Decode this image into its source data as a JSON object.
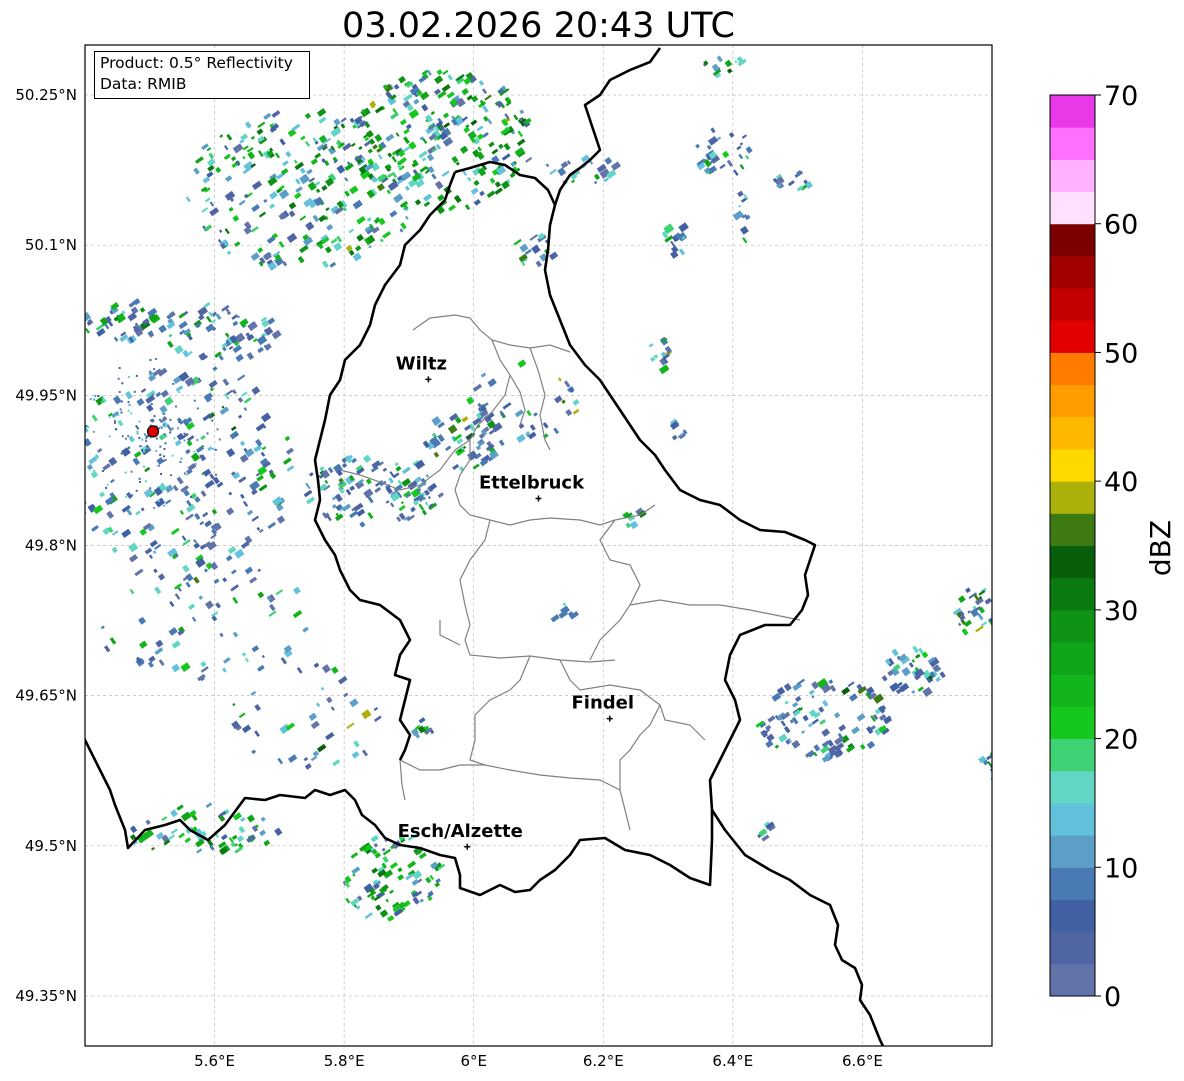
{
  "title": "03.02.2026 20:43 UTC",
  "info": {
    "product": "Product: 0.5° Reflectivity",
    "data": "Data: RMIB"
  },
  "map": {
    "lon_range": [
      5.4,
      6.8
    ],
    "lat_range": [
      49.3,
      50.3
    ],
    "lat_ticks": [
      {
        "label": "50.25°N",
        "value": 50.25
      },
      {
        "label": "50.1°N",
        "value": 50.1
      },
      {
        "label": "49.95°N",
        "value": 49.95
      },
      {
        "label": "49.8°N",
        "value": 49.8
      },
      {
        "label": "49.65°N",
        "value": 49.65
      },
      {
        "label": "49.5°N",
        "value": 49.5
      },
      {
        "label": "49.35°N",
        "value": 49.35
      }
    ],
    "lon_ticks": [
      {
        "label": "5.6°E",
        "value": 5.6
      },
      {
        "label": "5.8°E",
        "value": 5.8
      },
      {
        "label": "6°E",
        "value": 6.0
      },
      {
        "label": "6.2°E",
        "value": 6.2
      },
      {
        "label": "6.4°E",
        "value": 6.4
      },
      {
        "label": "6.6°E",
        "value": 6.6
      }
    ],
    "cities": [
      {
        "name": "Wiltz",
        "lon": 5.93,
        "lat": 49.966
      },
      {
        "name": "Ettelbruck",
        "lon": 6.1,
        "lat": 49.847
      },
      {
        "name": "Findel",
        "lon": 6.21,
        "lat": 49.627
      },
      {
        "name": "Esch/Alzette",
        "lon": 5.99,
        "lat": 49.499
      }
    ],
    "radar_site": {
      "lon": 5.505,
      "lat": 49.914
    }
  },
  "colorbar": {
    "label": "dBZ",
    "min": 0,
    "max": 70,
    "ticks": [
      "0",
      "10",
      "20",
      "30",
      "40",
      "50",
      "60",
      "70"
    ],
    "colors": [
      "#6173a8",
      "#4f65a4",
      "#4261a4",
      "#4a7ab3",
      "#5b9fc8",
      "#64c1dc",
      "#62d6c5",
      "#3fd274",
      "#14c81e",
      "#12b51b",
      "#10a418",
      "#0e9314",
      "#0a7a10",
      "#075f0c",
      "#3e7a12",
      "#acb00b",
      "#ffd800",
      "#ffb800",
      "#ff9c00",
      "#ff7c00",
      "#e20000",
      "#c20000",
      "#a00000",
      "#7d0000",
      "#ffe0ff",
      "#ffb0ff",
      "#ff70ff",
      "#e838e8"
    ]
  }
}
